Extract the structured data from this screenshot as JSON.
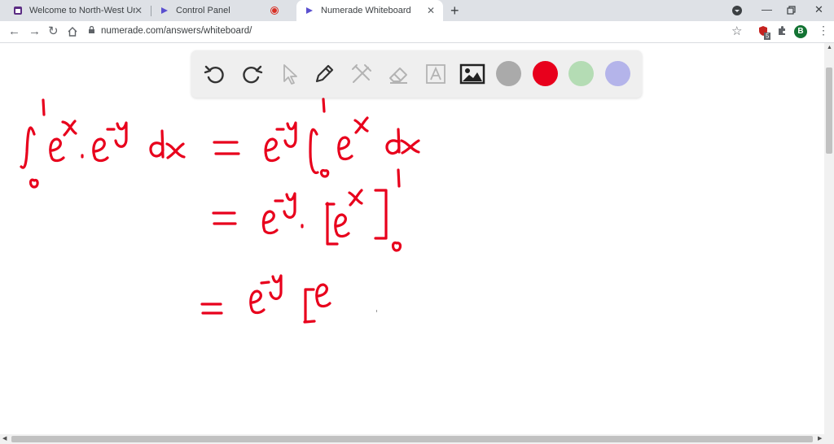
{
  "browser": {
    "tabs": [
      {
        "title": "Welcome to North-West Univers",
        "icon": "university-icon"
      },
      {
        "title": "Control Panel",
        "icon": "numerade-icon",
        "recording": true
      },
      {
        "title": "Numerade Whiteboard",
        "icon": "numerade-icon",
        "active": true
      }
    ],
    "address": "numerade.com/answers/whiteboard/",
    "extension_badge": "5",
    "profile_initial": "B"
  },
  "whiteboard": {
    "tools": [
      "undo-icon",
      "redo-icon",
      "pointer-icon",
      "pen-icon",
      "tools-icon",
      "eraser-icon",
      "text-icon",
      "image-icon"
    ],
    "colors": [
      "#aaaaaa",
      "#e8001c",
      "#b4dcb4",
      "#b4b4ea"
    ],
    "ink_color": "#e8001c",
    "handwritten": {
      "line1_left": "∫₀¹ eˣ · e⁻ʸ dx",
      "line1_right": "= e⁻ʸ ∫₀¹ eˣ dx",
      "line2": "= e⁻ʸ · [eˣ]₀¹",
      "line3": "= e⁻ʸ [e"
    }
  }
}
